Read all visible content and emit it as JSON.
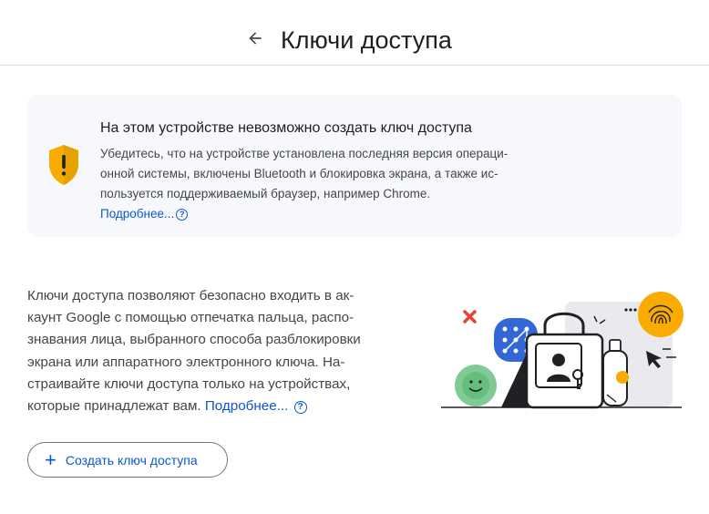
{
  "header": {
    "title": "Ключи доступа"
  },
  "warning": {
    "title": "На этом устройстве невозможно создать ключ доступа",
    "lines": [
      "Убедитесь, что на устройстве установлена последняя версия операци-",
      "онной системы, включены Bluetooth и блокировка экрана, а также ис-",
      "пользуется поддерживаемый браузер, например Chrome."
    ],
    "learn_more": "Подробнее..."
  },
  "description": {
    "lines": [
      "Ключи доступа позволяют безопасно входить в ак-",
      "каунт Google с помощью отпечатка пальца, распо-",
      "знавания лица, выбранного способа разблокировки",
      "экрана или аппаратного электронного ключа. На-",
      "страивайте ключи доступа только на устройствах,"
    ],
    "last_line": "которые принадлежат вам.",
    "learn_more": "Подробнее..."
  },
  "create_button": {
    "label": "Создать ключ доступа"
  },
  "colors": {
    "accent": "#0b57d0",
    "shield": "#f9ab00",
    "card_bg": "#f7f8fc"
  }
}
